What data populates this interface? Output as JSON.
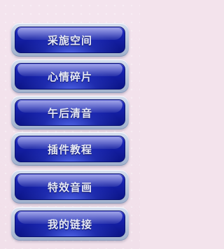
{
  "menu": {
    "items": [
      {
        "label": "采旎空间"
      },
      {
        "label": "心情碎片"
      },
      {
        "label": "午后清音"
      },
      {
        "label": "插件教程"
      },
      {
        "label": "特效音画"
      },
      {
        "label": "我的链接"
      }
    ]
  },
  "colors": {
    "background": "#f3e3ec",
    "button_blue": "#1520a8",
    "button_frame": "#b8c4dc",
    "label": "#e6e9f5"
  }
}
